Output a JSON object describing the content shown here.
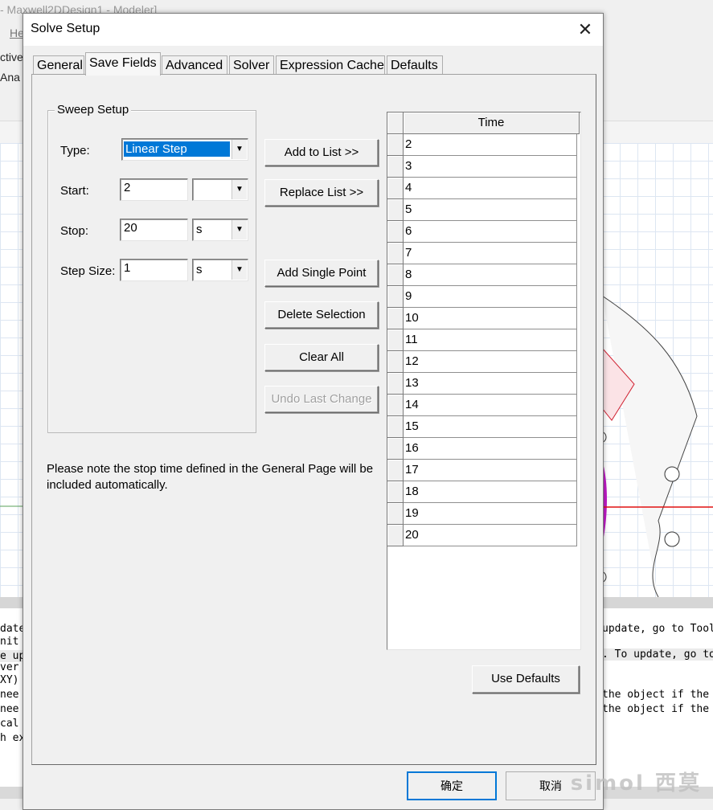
{
  "background_app": {
    "title": "- Maxwell2DDesign1 - Modeler]",
    "menu_fragment": "He",
    "active_label": "ctive:",
    "ana_label": "Ana",
    "left_messages": [
      "date",
      "nit",
      "e up",
      "ver",
      " XY)",
      " nee",
      " nee",
      "cal",
      "h ex"
    ],
    "right_messages": [
      "update, go to Tools",
      ". To update, go to",
      "the object if the",
      "the object if the"
    ]
  },
  "dialog": {
    "title": "Solve Setup",
    "close_glyph": "✕",
    "tabs": [
      "General",
      "Save Fields",
      "Advanced",
      "Solver",
      "Expression Cache",
      "Defaults"
    ],
    "active_tab": "Save Fields",
    "sweep_setup": {
      "legend": "Sweep Setup",
      "type_label": "Type:",
      "type_value": "Linear Step",
      "start_label": "Start:",
      "start_value": "2",
      "start_unit": "",
      "stop_label": "Stop:",
      "stop_value": "20",
      "stop_unit": "s",
      "step_label": "Step Size:",
      "step_value": "1",
      "step_unit": "s"
    },
    "buttons": {
      "add_to_list": "Add to List >>",
      "replace_list": "Replace List >>",
      "add_single_point": "Add Single Point",
      "delete_selection": "Delete Selection",
      "clear_all": "Clear All",
      "undo_last_change": "Undo Last Change",
      "use_defaults": "Use Defaults"
    },
    "note": "Please note the stop time defined in the General Page will be included automatically.",
    "time_table": {
      "header": "Time",
      "rows": [
        "2",
        "3",
        "4",
        "5",
        "6",
        "7",
        "8",
        "9",
        "10",
        "11",
        "12",
        "13",
        "14",
        "15",
        "16",
        "17",
        "18",
        "19",
        "20"
      ]
    },
    "footer": {
      "ok": "确定",
      "cancel": "取消"
    }
  },
  "watermark": "simol 西莫"
}
